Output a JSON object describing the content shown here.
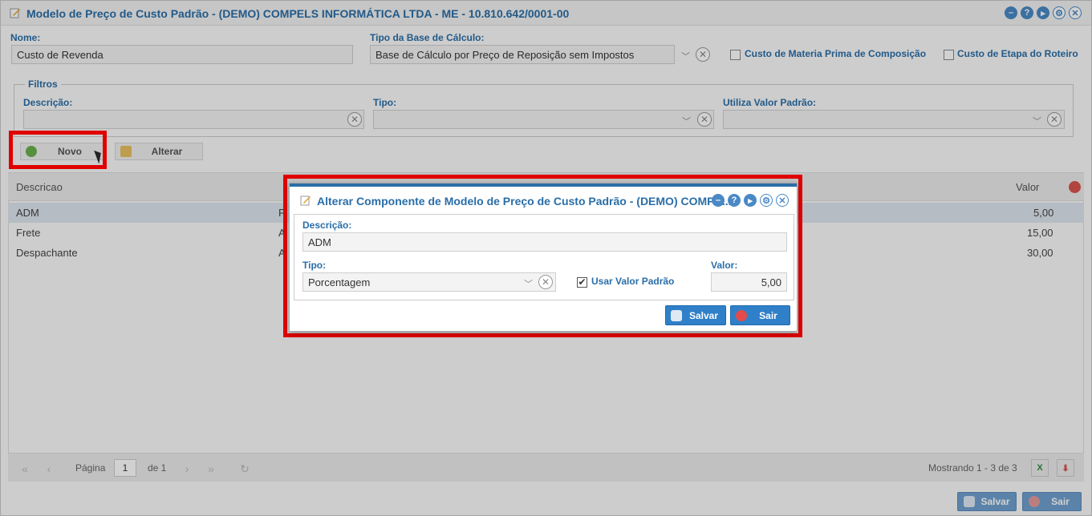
{
  "window": {
    "title": "Modelo de Preço de Custo Padrão - (DEMO) COMPELS INFORMÁTICA LTDA - ME - 10.810.642/0001-00",
    "controls": [
      "minimize-icon",
      "help-icon",
      "play-icon",
      "settings-icon",
      "close-icon"
    ]
  },
  "form": {
    "nome_label": "Nome:",
    "nome_value": "Custo de Revenda",
    "tipo_base_label": "Tipo da Base de Cálculo:",
    "tipo_base_value": "Base de Cálculo por Preço de Reposição sem Impostos",
    "custo_materia_label": "Custo de Materia Prima de Composição",
    "custo_etapa_label": "Custo de Etapa do Roteiro"
  },
  "filters": {
    "legend": "Filtros",
    "descricao_label": "Descrição:",
    "tipo_label": "Tipo:",
    "utiliza_label": "Utiliza Valor Padrão:"
  },
  "toolbar": {
    "novo_label": "Novo",
    "alterar_label": "Alterar"
  },
  "grid": {
    "columns": [
      "Descricao",
      "Valor"
    ],
    "rows": [
      {
        "descricao": "ADM",
        "tipo": "P",
        "valor": "5,00"
      },
      {
        "descricao": "Frete",
        "tipo": "A",
        "valor": "15,00"
      },
      {
        "descricao": "Despachante",
        "tipo": "A",
        "valor": "30,00"
      }
    ]
  },
  "pager": {
    "pagina_label": "Página",
    "page_value": "1",
    "de_label": "de 1",
    "showing": "Mostrando 1 - 3 de 3"
  },
  "footer": {
    "salvar_label": "Salvar",
    "sair_label": "Sair"
  },
  "modal": {
    "title": "Alterar Componente de Modelo de Preço de Custo Padrão - (DEMO) COMPE...",
    "descricao_label": "Descrição:",
    "descricao_value": "ADM",
    "tipo_label": "Tipo:",
    "tipo_value": "Porcentagem",
    "usar_valor_label": "Usar Valor Padrão",
    "usar_valor_checked": true,
    "valor_label": "Valor:",
    "valor_value": "5,00",
    "salvar_label": "Salvar",
    "sair_label": "Sair"
  },
  "colors": {
    "accent": "#2a6ea8",
    "highlight": "#e00000",
    "button_blue": "#2f80c8"
  }
}
